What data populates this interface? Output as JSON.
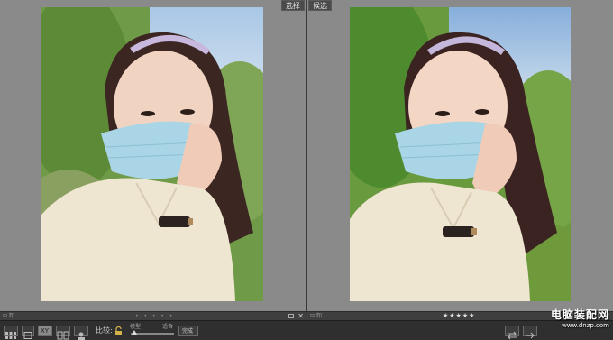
{
  "panes": {
    "left": {
      "tag": "选择",
      "strip_label": "⊟ 卸",
      "close": "✕",
      "dots": "• • • • •"
    },
    "right": {
      "tag": "候选",
      "strip_label": "⊟ 卸",
      "close": "✕",
      "stars": "★★★★★"
    }
  },
  "toolbar": {
    "compare_label": "比较:",
    "compare_value": "XY",
    "zoom_min": "模型",
    "zoom_max": "适合",
    "confirm_label": "完成",
    "buttons": [
      "grid-view",
      "loupe-view",
      "compare-view",
      "survey-view",
      "people-view"
    ]
  },
  "watermark": {
    "name": "电脑装配网",
    "url": "www.dnzp.com"
  },
  "colors": {
    "bg": "#707070",
    "toolbar": "#2f2f2f",
    "mask": "#a9d5e6",
    "shirt": "#efe6d2"
  }
}
